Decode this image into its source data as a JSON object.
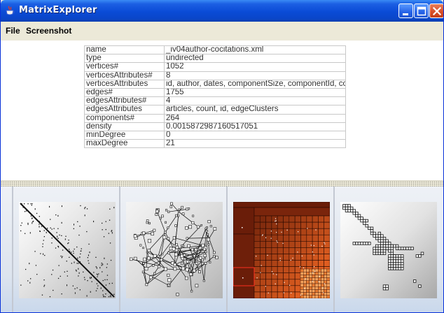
{
  "window": {
    "title": "MatrixExplorer",
    "icons": {
      "app": "java-cup-icon",
      "minimize": "minimize-icon",
      "maximize": "maximize-icon",
      "close": "close-icon"
    },
    "colors": {
      "titlebar": "#0a4bd6",
      "close_button": "#d9502a",
      "matrix_fill": "#8a2e12",
      "matrix_highlight": "#ff6a1a"
    }
  },
  "menubar": {
    "file": "File",
    "screenshot": "Screenshot"
  },
  "attributes": [
    {
      "key": "name",
      "value": "_iv04author-cocitations.xml"
    },
    {
      "key": "type",
      "value": "undirected"
    },
    {
      "key": "vertices#",
      "value": "1052"
    },
    {
      "key": "verticesAttributes#",
      "value": "8"
    },
    {
      "key": "verticesAttributes",
      "value": "id, author, dates, componentSize, componentId, com..."
    },
    {
      "key": "edges#",
      "value": "1755"
    },
    {
      "key": "edgesAttributes#",
      "value": "4"
    },
    {
      "key": "edgesAttributes",
      "value": "articles, count, id, edgeClusters"
    },
    {
      "key": "components#",
      "value": "264"
    },
    {
      "key": "density",
      "value": "0.0015872987160517051"
    },
    {
      "key": "minDegree",
      "value": "0"
    },
    {
      "key": "maxDegree",
      "value": "21"
    }
  ],
  "thumbnails": [
    {
      "name": "matrix-view-thumbnail"
    },
    {
      "name": "node-link-view-thumbnail"
    },
    {
      "name": "treemap-matrix-thumbnail"
    },
    {
      "name": "matrix-zoom-thumbnail"
    }
  ]
}
